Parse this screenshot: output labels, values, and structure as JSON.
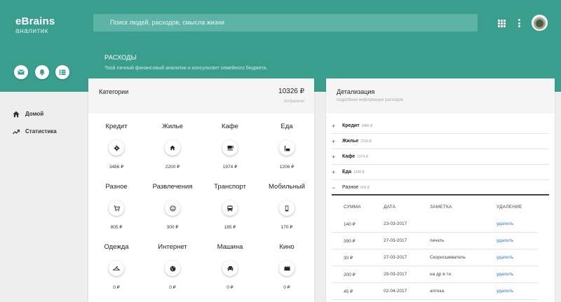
{
  "app": {
    "title": "eBrains",
    "subtitle": "аналитик"
  },
  "search": {
    "placeholder": "Поиск людей, расходов, смысла жизни"
  },
  "icons": {
    "apps": "apps-grid-icon",
    "more": "more-vert-icon",
    "mail": "mail-icon",
    "bell": "bell-icon",
    "list": "list-icon"
  },
  "page": {
    "title": "РАСХОДЫ",
    "subtitle": "Твой личный финансовый аналитик и консультант семейного бюджета."
  },
  "nav": [
    {
      "label": "Домой",
      "icon": "home-icon"
    },
    {
      "label": "Статистика",
      "icon": "trending-up-icon"
    }
  ],
  "categories": {
    "title": "Категории",
    "total": "10326 ₽",
    "total_label": "потрачено",
    "items": [
      {
        "name": "Кредит",
        "icon": "gear-icon",
        "amount": "3486 ₽"
      },
      {
        "name": "Жилье",
        "icon": "home-icon",
        "amount": "2200 ₽"
      },
      {
        "name": "Кафе",
        "icon": "coffee-icon",
        "amount": "1974 ₽"
      },
      {
        "name": "Еда",
        "icon": "food-icon",
        "amount": "1206 ₽"
      },
      {
        "name": "Разное",
        "icon": "cart-icon",
        "amount": "805 ₽"
      },
      {
        "name": "Развлечения",
        "icon": "smile-icon",
        "amount": "300 ₽"
      },
      {
        "name": "Транспорт",
        "icon": "bus-icon",
        "amount": "185 ₽"
      },
      {
        "name": "Мобильный",
        "icon": "phone-icon",
        "amount": "170 ₽"
      },
      {
        "name": "Одежда",
        "icon": "hanger-icon",
        "amount": "0 ₽"
      },
      {
        "name": "Интернет",
        "icon": "globe-icon",
        "amount": "0 ₽"
      },
      {
        "name": "Машина",
        "icon": "car-icon",
        "amount": "0 ₽"
      },
      {
        "name": "Кино",
        "icon": "film-icon",
        "amount": "0 ₽"
      }
    ]
  },
  "details": {
    "title": "Детализация",
    "subtitle": "подробная информация расходов",
    "rows": [
      {
        "sign": "+",
        "name": "Кредит",
        "amount": "3486 ₽"
      },
      {
        "sign": "+",
        "name": "Жилье",
        "amount": "2200 ₽"
      },
      {
        "sign": "+",
        "name": "Кафе",
        "amount": "1974 ₽"
      },
      {
        "sign": "+",
        "name": "Еда",
        "amount": "1206 ₽"
      },
      {
        "sign": "−",
        "name": "Разное",
        "amount": "805 ₽"
      }
    ],
    "table": {
      "headers": [
        "СУММА",
        "ДАТА",
        "ЗАМЕТКА",
        "УДАЛЕНИЕ"
      ],
      "rows": [
        {
          "sum": "140 ₽",
          "date": "23-03-2017",
          "note": "",
          "action": "удалить"
        },
        {
          "sum": "390 ₽",
          "date": "27-03-2017",
          "note": "печать",
          "action": "удалить"
        },
        {
          "sum": "30 ₽",
          "date": "27-03-2017",
          "note": "Скоросшиватель",
          "action": "удалить"
        },
        {
          "sum": "200 ₽",
          "date": "29-03-2017",
          "note": "на др в тн",
          "action": "удалить"
        },
        {
          "sum": "45 ₽",
          "date": "02-04-2017",
          "note": "аптека",
          "action": "удалить"
        }
      ]
    }
  },
  "colors": {
    "accent": "#3a9e8e",
    "search_bg": "#5db3a6",
    "link": "#2b7bd6"
  }
}
